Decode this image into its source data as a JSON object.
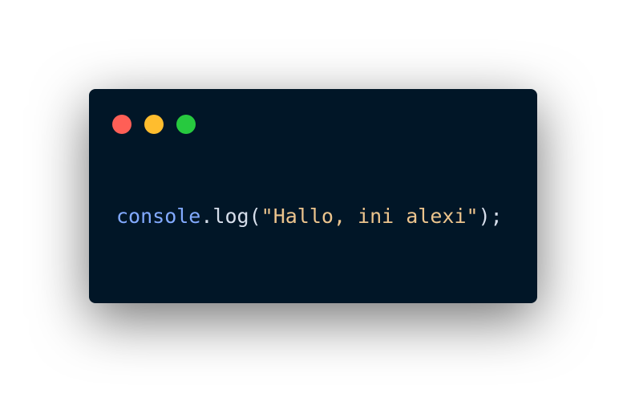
{
  "window": {
    "traffic_lights": [
      {
        "name": "close",
        "color": "#ff5f56"
      },
      {
        "name": "minimize",
        "color": "#ffbd2e"
      },
      {
        "name": "maximize",
        "color": "#27c93f"
      }
    ],
    "background": "#011627"
  },
  "code": {
    "tokens": {
      "object": "console",
      "dot": ".",
      "method": "log",
      "open_paren": "(",
      "string": "\"Hallo, ini alexi\"",
      "close_paren": ")",
      "semicolon": ";"
    },
    "colors": {
      "object": "#82aaff",
      "method": "#d6deeb",
      "string": "#ecc48d",
      "punctuation": "#d6deeb"
    }
  }
}
